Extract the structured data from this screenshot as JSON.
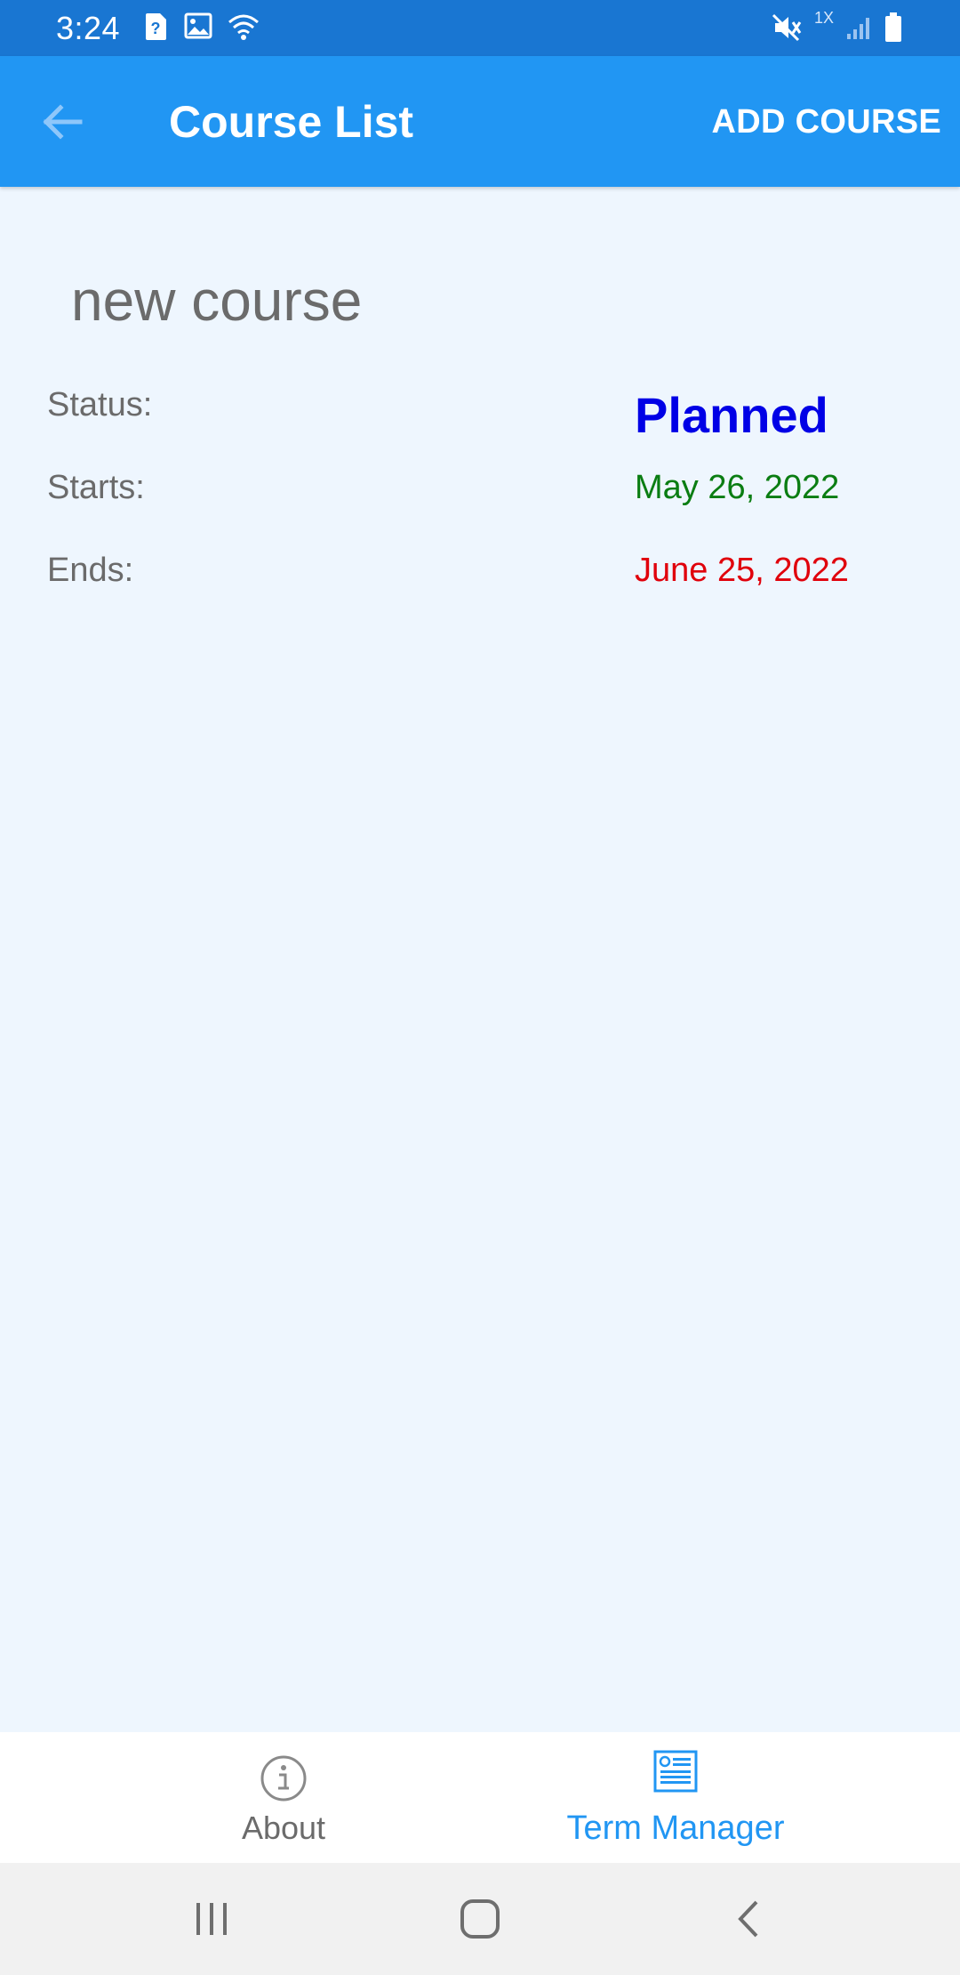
{
  "status_bar": {
    "time": "3:24",
    "network_label": "1X"
  },
  "app_bar": {
    "title": "Course List",
    "action_label": "ADD COURSE"
  },
  "course": {
    "name": "new course",
    "status_label": "Status:",
    "status_value": "Planned",
    "starts_label": "Starts:",
    "starts_value": "May 26, 2022",
    "ends_label": "Ends:",
    "ends_value": "June 25, 2022"
  },
  "tabs": [
    {
      "label": "About",
      "icon": "info-icon",
      "selected": false
    },
    {
      "label": "Term Manager",
      "icon": "term-manager-icon",
      "selected": true
    }
  ],
  "colors": {
    "status_bar": "#1976D2",
    "app_bar": "#2196F3",
    "content_bg": "#EEF6FE",
    "status_planned": "#0000E6",
    "start_date": "#0A7D12",
    "end_date": "#E0000B",
    "tab_selected": "#2196F3",
    "tab_unselected": "#6B6B6B"
  }
}
